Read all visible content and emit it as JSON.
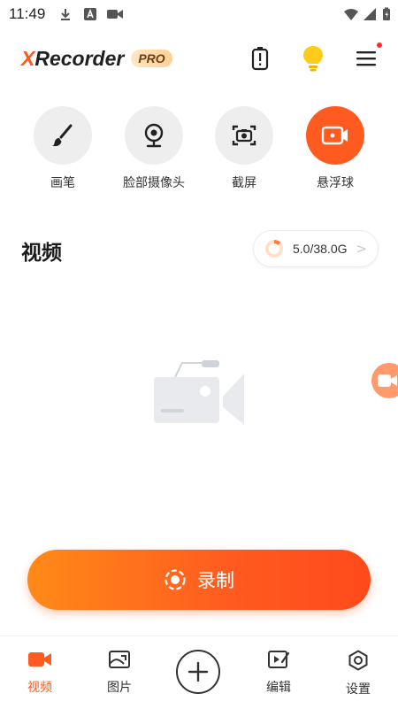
{
  "status_bar": {
    "time": "11:49"
  },
  "header": {
    "logo_x": "X",
    "logo_text": "Recorder",
    "pro_badge": "PRO"
  },
  "tools": [
    {
      "label": "画笔",
      "icon": "brush-icon"
    },
    {
      "label": "脸部摄像头",
      "icon": "webcam-icon"
    },
    {
      "label": "截屏",
      "icon": "screenshot-icon"
    },
    {
      "label": "悬浮球",
      "icon": "floating-ball-icon",
      "active": true
    }
  ],
  "section": {
    "title": "视频",
    "storage": "5.0/38.0G",
    "storage_used_fraction": 0.13
  },
  "record_button": {
    "label": "录制"
  },
  "bottom_nav": [
    {
      "label": "视频",
      "icon": "video-icon",
      "active": true
    },
    {
      "label": "图片",
      "icon": "image-icon"
    },
    {
      "label": "",
      "icon": "add-icon"
    },
    {
      "label": "编辑",
      "icon": "edit-icon"
    },
    {
      "label": "设置",
      "icon": "settings-icon"
    }
  ],
  "colors": {
    "accent": "#ff5a1f",
    "accent_gradient_start": "#ff8a18",
    "tool_bg": "#eeeeee",
    "notification_dot": "#ff2a2a"
  }
}
